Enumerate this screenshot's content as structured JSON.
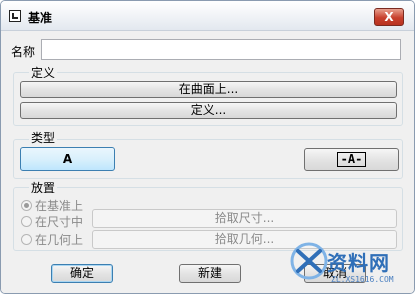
{
  "window": {
    "title": "基准",
    "close_symbol": "X"
  },
  "name": {
    "label": "名称",
    "value": ""
  },
  "definition": {
    "legend": "定义",
    "on_surface_label": "在曲面上...",
    "define_label": "定义..."
  },
  "type": {
    "legend": "类型",
    "plain_label": "A",
    "boxed_label": "-A-"
  },
  "placement": {
    "legend": "放置",
    "radio_on_datum": "在基准上",
    "radio_in_dimension": "在尺寸中",
    "radio_on_geometry": "在几何上",
    "pick_dimension_label": "拾取尺寸...",
    "pick_geometry_label": "拾取几何..."
  },
  "footer": {
    "ok_label": "确定",
    "new_label": "新建",
    "cancel_label": "取消"
  },
  "watermark": {
    "text": "资料网",
    "url": "ZL.XS1616.COM"
  },
  "icons": {
    "app": "datum-icon",
    "close": "close-icon"
  },
  "colors": {
    "close_button": "#c7402d",
    "default_button_border": "#3c7fb1",
    "watermark": "#2f6fb8"
  }
}
